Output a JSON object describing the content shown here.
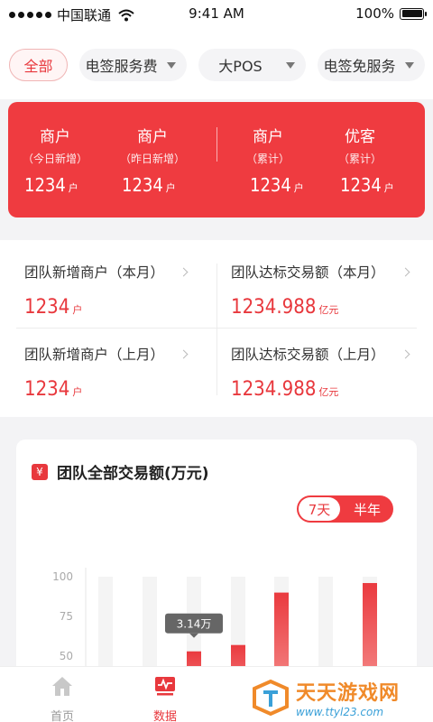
{
  "status_bar": {
    "carrier": "中国联通",
    "time": "9:41 AM",
    "battery": "100%",
    "battery_level": 1.0
  },
  "filters": {
    "all": "全部",
    "service_fee": "电签服务费",
    "big_pos": "大POS",
    "free_service": "电签免服务"
  },
  "summary": {
    "unit": "户",
    "columns": [
      {
        "title": "商户",
        "sub": "（今日新增）",
        "value": "1234"
      },
      {
        "title": "商户",
        "sub": "（昨日新增）",
        "value": "1234"
      },
      {
        "title": "商户",
        "sub": "（累计）",
        "value": "1234"
      },
      {
        "title": "优客",
        "sub": "（累计）",
        "value": "1234"
      }
    ]
  },
  "stats": {
    "items": [
      {
        "title": "团队新增商户（本月）",
        "value": "1234",
        "unit": "户"
      },
      {
        "title": "团队达标交易额（本月）",
        "value": "1234.988",
        "unit": "亿元"
      },
      {
        "title": "团队新增商户（上月）",
        "value": "1234",
        "unit": "户"
      },
      {
        "title": "团队达标交易额（上月）",
        "value": "1234.988",
        "unit": "亿元"
      }
    ]
  },
  "chart": {
    "title": "团队全部交易额(万元)",
    "currency_symbol": "¥",
    "toggle": {
      "selected": "7天",
      "other": "半年"
    },
    "tooltip": "3.14万"
  },
  "chart_data": {
    "type": "bar",
    "title": "团队全部交易额(万元)",
    "y_ticks": [
      100,
      75,
      50
    ],
    "ylim": [
      25,
      100
    ],
    "values": [
      null,
      null,
      53,
      57,
      90,
      null,
      96
    ],
    "background_bar_max": 100,
    "grid": false,
    "highlight_color": "#ea3a3f"
  },
  "tabbar": {
    "home": "首页",
    "data": "数据"
  },
  "watermark": {
    "name": "天天游戏网",
    "url": "www.ttyl23.com"
  }
}
